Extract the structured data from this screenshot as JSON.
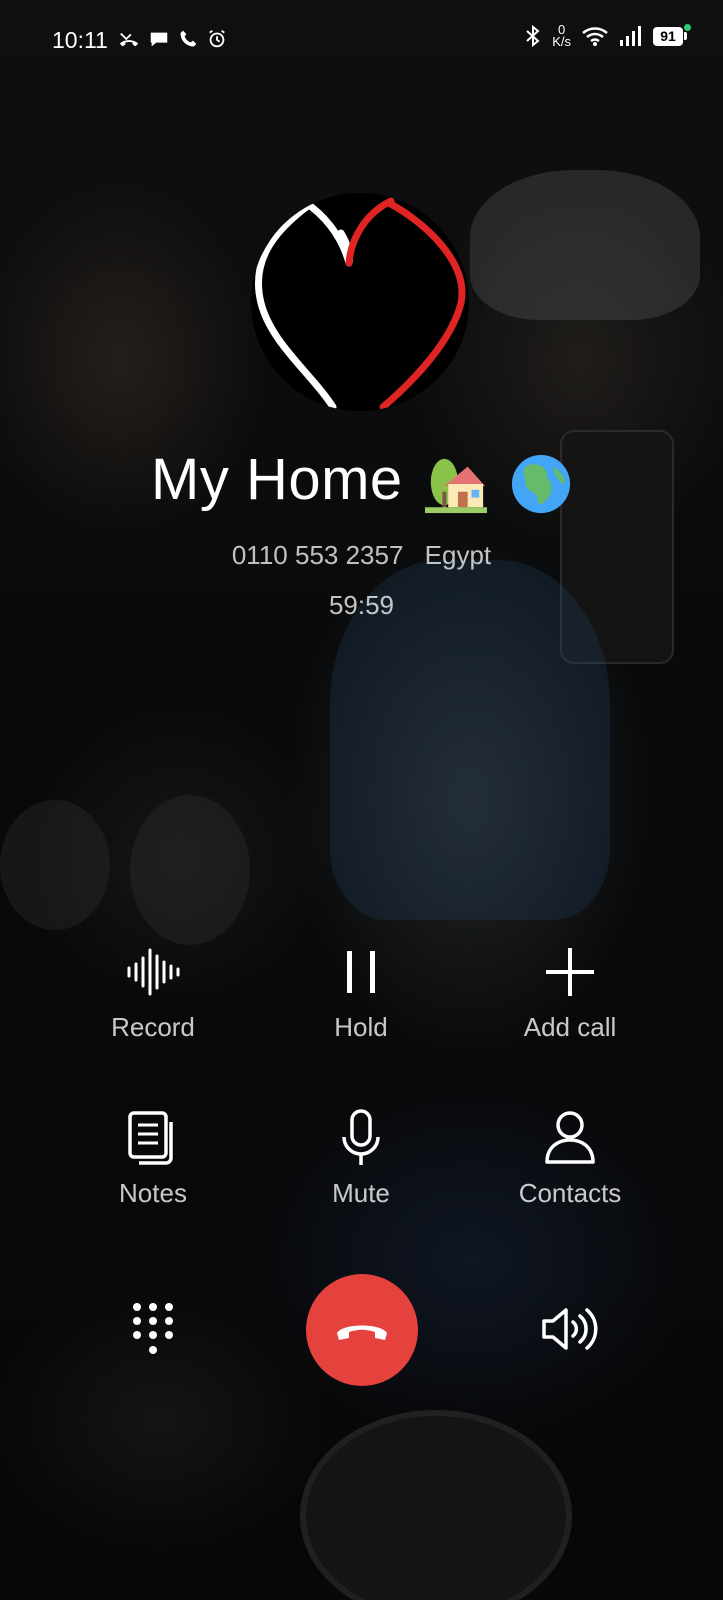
{
  "status_bar": {
    "time": "10:11",
    "net_speed_value": "0",
    "net_speed_unit": "K/s",
    "battery": "91",
    "left_icons": [
      "missed-call-icon",
      "message-icon",
      "phone-icon",
      "alarm-icon"
    ],
    "right_icons": [
      "bluetooth-icon",
      "wifi-icon",
      "signal-icon",
      "battery-icon"
    ]
  },
  "caller": {
    "name": "My Home",
    "emojis": [
      "house-with-garden-emoji",
      "globe-africa-emoji"
    ],
    "number": "0110 553 2357",
    "location": "Egypt",
    "duration": "59:59"
  },
  "controls": {
    "record": "Record",
    "hold": "Hold",
    "add_call": "Add call",
    "notes": "Notes",
    "mute": "Mute",
    "contacts": "Contacts"
  },
  "bottom": {
    "icons": [
      "dialpad-icon",
      "end-call-icon",
      "speaker-icon"
    ]
  },
  "colors": {
    "end_call": "#e5423d",
    "heart_red": "#e02424",
    "heart_white": "#ffffff"
  }
}
